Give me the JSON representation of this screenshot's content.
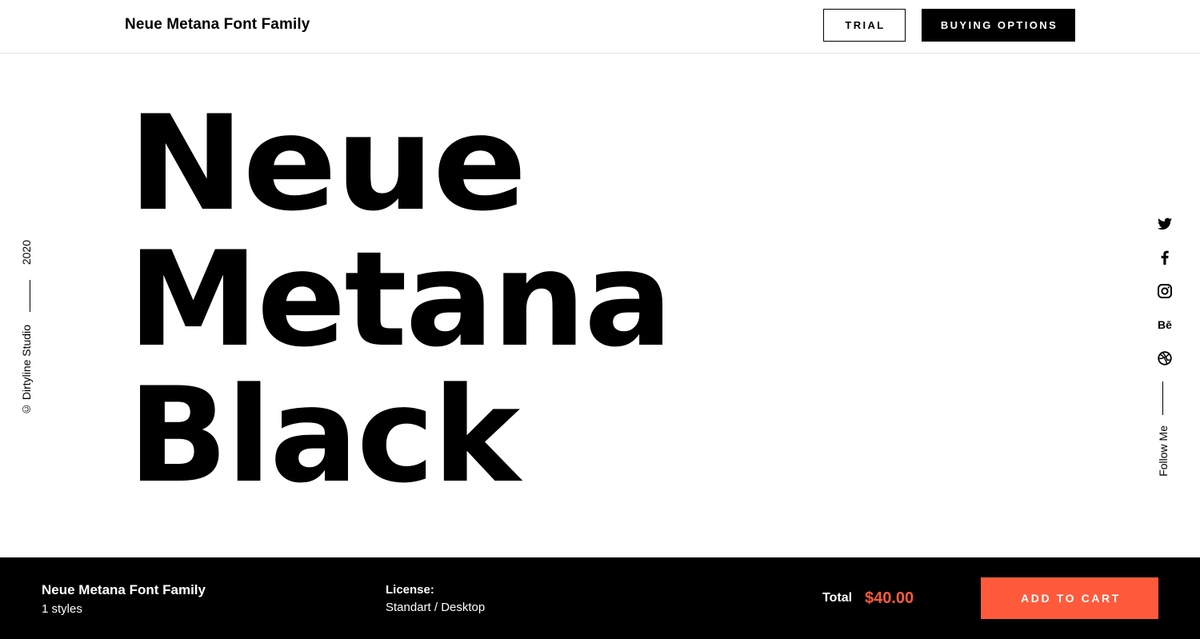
{
  "header": {
    "brand": "Neue Metana Font Family",
    "trial_label": "TRIAL",
    "buy_label": "BUYING OPTIONS"
  },
  "hero": {
    "lines": [
      "Neue",
      "Metana",
      "Black"
    ]
  },
  "left_meta": {
    "year": "2020",
    "copyright": "© Dirtyline Studio"
  },
  "social": {
    "icons": [
      "twitter-icon",
      "facebook-icon",
      "instagram-icon",
      "behance-icon",
      "dribbble-icon"
    ],
    "behance_glyph": "Bē",
    "follow_label": "Follow Me"
  },
  "footer": {
    "title": "Neue Metana Font Family",
    "styles": "1 styles",
    "license_label": "License:",
    "license_value": "Standart / Desktop",
    "total_label": "Total",
    "total_value": "$40.00",
    "cart_label": "ADD TO CART"
  },
  "colors": {
    "accent": "#ff5a3c",
    "dark": "#000000",
    "background": "#ffffff"
  }
}
